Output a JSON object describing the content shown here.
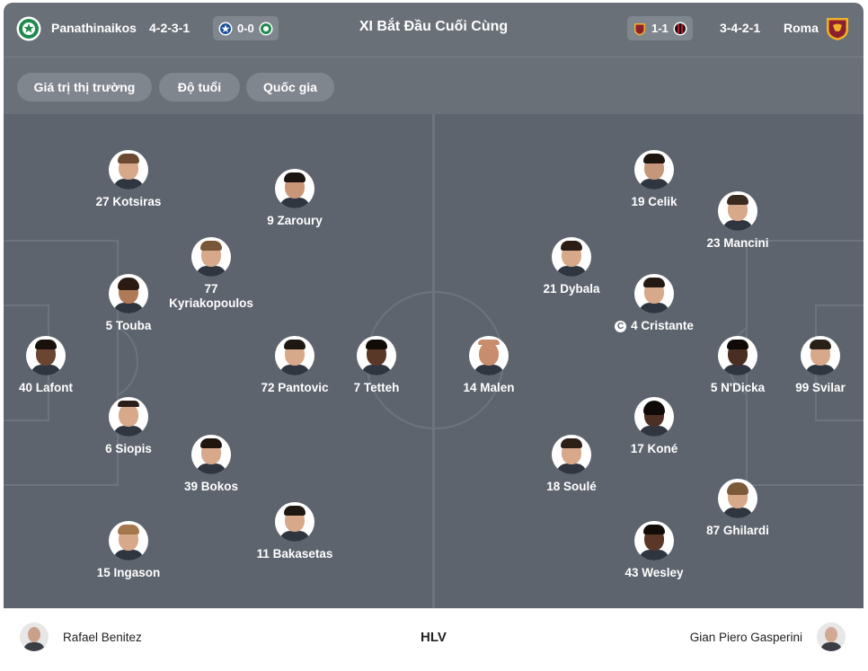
{
  "header": {
    "home_team": "Panathinaikos",
    "home_formation": "4-2-3-1",
    "home_score": "0-0",
    "title": "XI Bắt Đầu Cuối Cùng",
    "away_score": "1-1",
    "away_formation": "3-4-2-1",
    "away_team": "Roma"
  },
  "colors": {
    "panathinaikos": "#1f8a4c",
    "atromitos": "#1b4f9c",
    "roma": "#f0b323",
    "milan": "#c8102e",
    "header_bg": "#6a7078",
    "pitch_bg": "#5d646d"
  },
  "filters": [
    "Giá trị thị trường",
    "Độ tuổi",
    "Quốc gia"
  ],
  "home_players": [
    {
      "label": "27 Kotsiras"
    },
    {
      "label": "9 Zaroury"
    },
    {
      "label": "77 Kyriakopoulos"
    },
    {
      "label": "5 Touba"
    },
    {
      "label": "40 Lafont"
    },
    {
      "label": "72 Pantovic"
    },
    {
      "label": "7 Tetteh"
    },
    {
      "label": "6 Siopis"
    },
    {
      "label": "39 Bokos"
    },
    {
      "label": "15 Ingason"
    },
    {
      "label": "11 Bakasetas"
    }
  ],
  "away_players": [
    {
      "label": "19 Celik"
    },
    {
      "label": "23 Mancini"
    },
    {
      "label": "21 Dybala"
    },
    {
      "label": "4 Cristante",
      "captain": "C"
    },
    {
      "label": "14 Malen"
    },
    {
      "label": "5 N'Dicka"
    },
    {
      "label": "99 Svilar"
    },
    {
      "label": "17 Koné"
    },
    {
      "label": "18 Soulé"
    },
    {
      "label": "87 Ghilardi"
    },
    {
      "label": "43 Wesley"
    }
  ],
  "coaches": {
    "home": "Rafael Benitez",
    "label": "HLV",
    "away": "Gian Piero Gasperini"
  }
}
